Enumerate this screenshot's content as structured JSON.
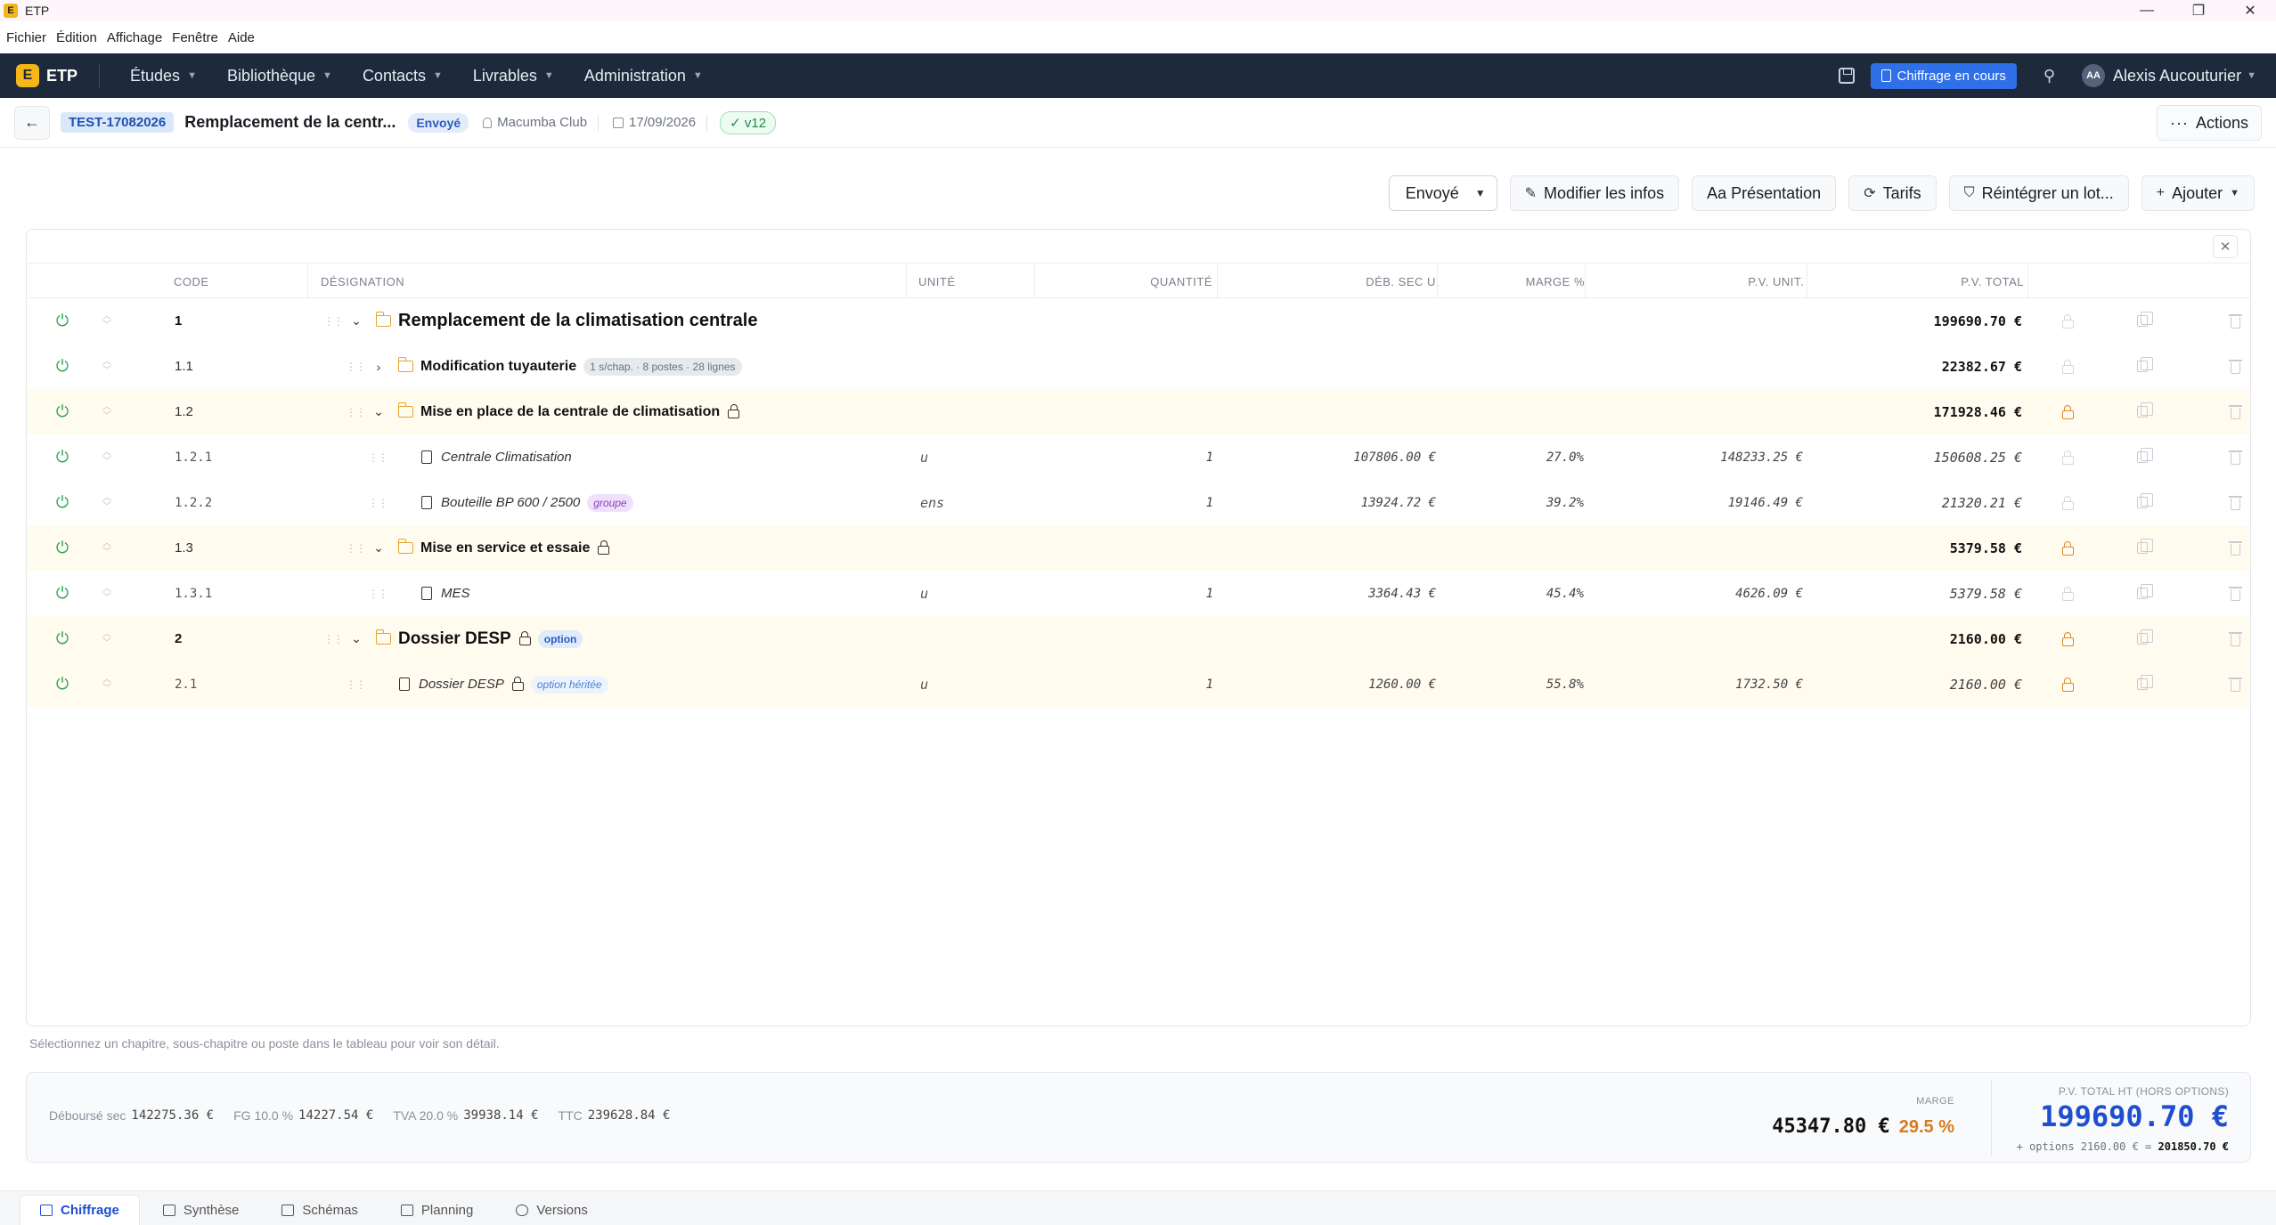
{
  "window": {
    "title": "ETP",
    "app_icon_letter": "E",
    "min": "—",
    "restore": "❐",
    "close": "✕"
  },
  "menu": [
    "Fichier",
    "Édition",
    "Affichage",
    "Fenêtre",
    "Aide"
  ],
  "nav": {
    "logo_letter": "E",
    "logo_text": "ETP",
    "items": [
      "Études",
      "Bibliothèque",
      "Contacts",
      "Livrables",
      "Administration"
    ],
    "chiffrage_button": "Chiffrage en cours",
    "user_initials": "AA",
    "user_name": "Alexis Aucouturier"
  },
  "header": {
    "back": "←",
    "code": "TEST-17082026",
    "title": "Remplacement de la centr...",
    "status": "Envoyé",
    "client": "Macumba Club",
    "date": "17/09/2026",
    "version": "✓ v12",
    "actions_label": "Actions",
    "actions_dots": "···"
  },
  "toolbar": {
    "status_select": "Envoyé",
    "modifier": "Modifier les infos",
    "presentation": "Aa Présentation",
    "tarifs": "Tarifs",
    "reintegrer": "Réintégrer un lot...",
    "ajouter": "Ajouter"
  },
  "table": {
    "columns": {
      "code": "CODE",
      "designation": "DÉSIGNATION",
      "unite": "UNITÉ",
      "quantite": "QUANTITÉ",
      "deb_sec": "DÉB. SEC U.",
      "marge": "MARGE %",
      "pv_unit": "P.V. UNIT.",
      "pv_total": "P.V. TOTAL"
    },
    "rows": [
      {
        "code": "1",
        "designation": "Remplacement de la climatisation centrale",
        "total": "199690.70 €"
      },
      {
        "code": "1.1",
        "designation": "Modification tuyauterie",
        "chip": "1 s/chap. · 8 postes · 28 lignes",
        "total": "22382.67 €"
      },
      {
        "code": "1.2",
        "designation": "Mise en place de la centrale de climatisation",
        "total": "171928.46 €"
      },
      {
        "code": "1.2.1",
        "designation": "Centrale Climatisation",
        "unite": "u",
        "quantite": "1",
        "deb_sec": "107806.00 €",
        "marge": "27.0%",
        "pv_unit": "148233.25 €",
        "total": "150608.25 €"
      },
      {
        "code": "1.2.2",
        "designation": "Bouteille BP 600 / 2500",
        "chip": "groupe",
        "unite": "ens",
        "quantite": "1",
        "deb_sec": "13924.72 €",
        "marge": "39.2%",
        "pv_unit": "19146.49 €",
        "total": "21320.21 €"
      },
      {
        "code": "1.3",
        "designation": "Mise en service et essaie",
        "total": "5379.58 €"
      },
      {
        "code": "1.3.1",
        "designation": "MES",
        "unite": "u",
        "quantite": "1",
        "deb_sec": "3364.43 €",
        "marge": "45.4%",
        "pv_unit": "4626.09 €",
        "total": "5379.58 €"
      },
      {
        "code": "2",
        "designation": "Dossier DESP",
        "chip": "option",
        "total": "2160.00 €"
      },
      {
        "code": "2.1",
        "designation": "Dossier DESP",
        "chip": "option héritée",
        "unite": "u",
        "quantite": "1",
        "deb_sec": "1260.00 €",
        "marge": "55.8%",
        "pv_unit": "1732.50 €",
        "total": "2160.00 €"
      }
    ]
  },
  "hint": "Sélectionnez un chapitre, sous-chapitre ou poste dans le tableau pour voir son détail.",
  "summary": {
    "debourse_label": "Déboursé sec",
    "debourse": "142275.36 €",
    "fg_label": "FG 10.0 %",
    "fg": "14227.54 €",
    "tva_label": "TVA 20.0 %",
    "tva": "39938.14 €",
    "ttc_label": "TTC",
    "ttc": "239628.84 €",
    "marge_label": "MARGE",
    "marge": "45347.80 €",
    "marge_pct": "29.5 %",
    "pv_total_label": "P.V. TOTAL HT (HORS OPTIONS)",
    "pv_total": "199690.70 €",
    "options_text": "+ options 2160.00 € =",
    "options_total": "201850.70 €"
  },
  "tabs": [
    "Chiffrage",
    "Synthèse",
    "Schémas",
    "Planning",
    "Versions"
  ],
  "colors": {
    "nav_bg": "#1e2a3b",
    "accent": "#2f6fe8",
    "logo": "#f5b617",
    "highlight_row": "#fffbef"
  }
}
